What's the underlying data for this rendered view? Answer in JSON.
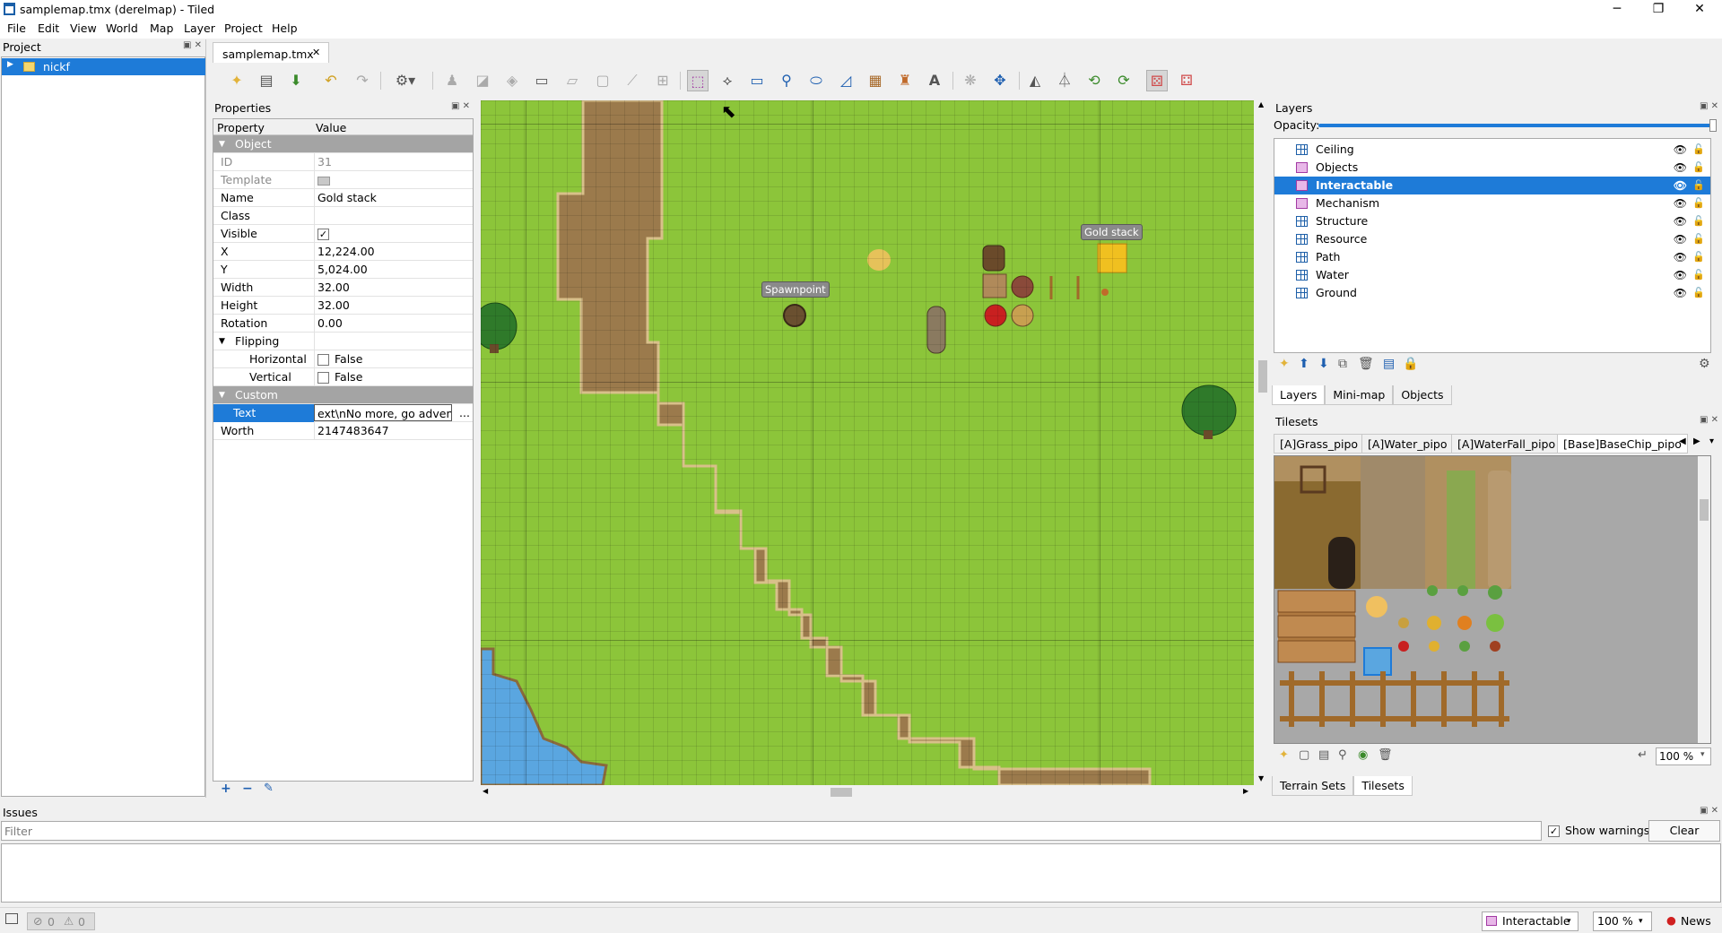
{
  "window": {
    "title": "samplemap.tmx (derelmap) - Tiled",
    "minimize": "─",
    "restore": "❐",
    "close": "✕"
  },
  "menu": [
    "File",
    "Edit",
    "View",
    "World",
    "Map",
    "Layer",
    "Project",
    "Help"
  ],
  "project": {
    "title": "Project",
    "items": [
      {
        "label": "nickf"
      }
    ]
  },
  "tabs": [
    {
      "label": "samplemap.tmx",
      "close": "✕"
    }
  ],
  "toolbar": {
    "icons": [
      "new-map",
      "open",
      "save",
      "undo",
      "redo",
      "commands",
      "stamp-brush",
      "terrain-brush",
      "wang-brush",
      "bucket-fill",
      "shape-fill",
      "eraser",
      "rectangle-select",
      "magic-wand",
      "select-same-tile",
      "select-objects",
      "edit-polygons",
      "insert-rectangle",
      "insert-point",
      "insert-ellipse",
      "insert-polygon",
      "insert-tile",
      "insert-template",
      "insert-text",
      "world-tool",
      "transform-tool",
      "flip-horizontal",
      "flip-vertical",
      "rotate-left",
      "rotate-right",
      "random-mode",
      "wang-fill"
    ]
  },
  "properties": {
    "title": "Properties",
    "columns": [
      "Property",
      "Value"
    ],
    "groups": [
      {
        "name": "Object",
        "rows": [
          {
            "key": "ID",
            "value": "31",
            "dim": true
          },
          {
            "key": "Template",
            "value": "",
            "dim": true
          },
          {
            "key": "Name",
            "value": "Gold stack"
          },
          {
            "key": "Class",
            "value": ""
          },
          {
            "key": "Visible",
            "value": "✓",
            "checkbox": true
          },
          {
            "key": "X",
            "value": "12,224.00"
          },
          {
            "key": "Y",
            "value": "5,024.00"
          },
          {
            "key": "Width",
            "value": "32.00"
          },
          {
            "key": "Height",
            "value": "32.00"
          },
          {
            "key": "Rotation",
            "value": "0.00"
          }
        ]
      },
      {
        "name": "Flipping",
        "sub": true,
        "rows": [
          {
            "key": "Horizontal",
            "value": "False",
            "checkbox": true
          },
          {
            "key": "Vertical",
            "value": "False",
            "checkbox": true
          }
        ]
      },
      {
        "name": "Custom Properties",
        "rows": [
          {
            "key": "Text",
            "value": "ext\\nNo more, go adventure",
            "selected": true,
            "more": "..."
          },
          {
            "key": "Worth",
            "value": "2147483647"
          }
        ]
      }
    ],
    "footer": {
      "add": "+",
      "remove": "−",
      "rename": "✎"
    }
  },
  "map": {
    "labels": {
      "spawn": "Spawnpoint",
      "gold": "Gold stack"
    }
  },
  "layers": {
    "title": "Layers",
    "opacity_label": "Opacity:",
    "opacity": 1.0,
    "items": [
      {
        "name": "Ceiling",
        "type": "tile"
      },
      {
        "name": "Objects",
        "type": "object"
      },
      {
        "name": "Interactable",
        "type": "object",
        "selected": true
      },
      {
        "name": "Mechanism",
        "type": "object"
      },
      {
        "name": "Structure",
        "type": "tile"
      },
      {
        "name": "Resource",
        "type": "tile"
      },
      {
        "name": "Path",
        "type": "tile"
      },
      {
        "name": "Water",
        "type": "tile"
      },
      {
        "name": "Ground",
        "type": "tile"
      }
    ],
    "bottom_tabs": [
      "Layers",
      "Mini-map",
      "Objects"
    ]
  },
  "tilesets": {
    "title": "Tilesets",
    "tabs": [
      "[A]Grass_pipo",
      "[A]Water_pipo",
      "[A]WaterFall_pipo",
      "[Base]BaseChip_pipo"
    ],
    "zoom": "100 %",
    "bottom_tabs": [
      "Terrain Sets",
      "Tilesets"
    ]
  },
  "issues": {
    "title": "Issues",
    "filter_placeholder": "Filter",
    "show_warnings": "Show warnings",
    "clear": "Clear"
  },
  "status": {
    "errors": "0",
    "warnings": "0",
    "layer": "Interactable",
    "zoom": "100 %",
    "news": "News"
  },
  "colors": {
    "accent": "#1e7bd8",
    "grass": "#8cc53a",
    "path": "#9b7a4c",
    "water": "#5aa6e0"
  }
}
